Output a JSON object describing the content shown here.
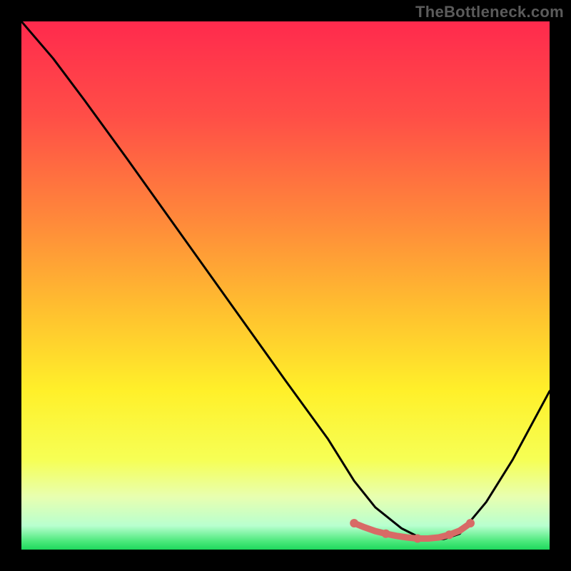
{
  "watermark": "TheBottleneck.com",
  "chart_data": {
    "type": "line",
    "title": "",
    "xlabel": "",
    "ylabel": "",
    "x_range": [
      0,
      100
    ],
    "y_range": [
      0,
      100
    ],
    "background_gradient_stops": [
      {
        "pos": 0.0,
        "color": "#ff2a4d"
      },
      {
        "pos": 0.18,
        "color": "#ff4e47"
      },
      {
        "pos": 0.38,
        "color": "#ff8a3a"
      },
      {
        "pos": 0.55,
        "color": "#ffc12f"
      },
      {
        "pos": 0.7,
        "color": "#fff02a"
      },
      {
        "pos": 0.83,
        "color": "#f6ff55"
      },
      {
        "pos": 0.9,
        "color": "#e8ffb0"
      },
      {
        "pos": 0.955,
        "color": "#b8ffcf"
      },
      {
        "pos": 0.985,
        "color": "#49e87a"
      },
      {
        "pos": 1.0,
        "color": "#1fd85d"
      }
    ],
    "series": [
      {
        "name": "bottleneck-curve",
        "color": "#000000",
        "x": [
          0,
          6,
          12,
          20,
          30,
          40,
          50,
          58,
          63,
          67,
          72,
          76,
          80,
          83,
          88,
          93,
          100
        ],
        "values": [
          100,
          93,
          85,
          74,
          60,
          46,
          32,
          21,
          13,
          8,
          4,
          2,
          2,
          3,
          9,
          17,
          30
        ]
      },
      {
        "name": "optimum-markers",
        "color": "#d86a66",
        "marker": "dot",
        "x": [
          63,
          65,
          67,
          69,
          71,
          73,
          75,
          77,
          79,
          81,
          83,
          85
        ],
        "values": [
          5,
          4.2,
          3.5,
          3.0,
          2.6,
          2.3,
          2.1,
          2.1,
          2.3,
          2.8,
          3.6,
          5.0
        ]
      }
    ],
    "annotations": []
  }
}
